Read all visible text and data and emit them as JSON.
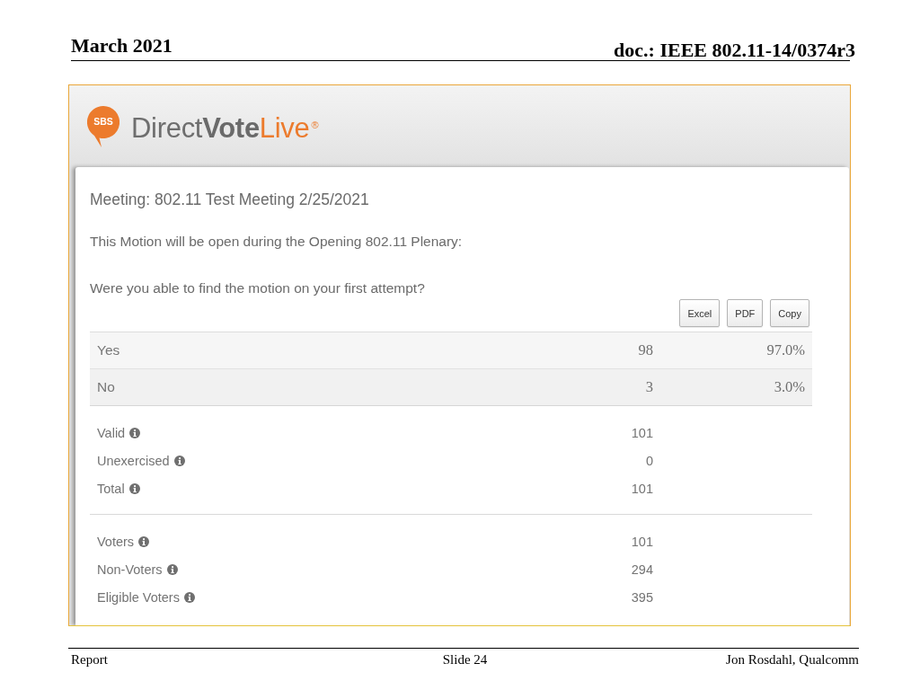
{
  "slide_header": {
    "date": "March 2021",
    "document_id": "doc.: IEEE 802.11-14/0374r3"
  },
  "vote_app": {
    "logo": {
      "badge": "SBS",
      "words": [
        {
          "text": "Direct",
          "kind": "plain"
        },
        {
          "text": "Vote",
          "kind": "strong"
        },
        {
          "text": "Live",
          "kind": "accent"
        },
        {
          "text": "®",
          "kind": "mark"
        }
      ]
    },
    "meeting": "Meeting: 802.11 Test Meeting 2/25/2021",
    "motion": "This Motion will be open during the Opening 802.11 Plenary:",
    "question": "Were you able to find the motion on your first attempt?",
    "export_buttons": [
      "Excel",
      "PDF",
      "Copy"
    ],
    "results": [
      {
        "answer": "Yes",
        "count": "98",
        "percent": "97.0%"
      },
      {
        "answer": "No",
        "count": "3",
        "percent": "3.0%"
      }
    ],
    "stat_groups": [
      {
        "rows": [
          {
            "label": "Valid",
            "value": "101"
          },
          {
            "label": "Unexercised",
            "value": "0"
          },
          {
            "label": "Total",
            "value": "101"
          }
        ]
      },
      {
        "rows": [
          {
            "label": "Voters",
            "value": "101"
          },
          {
            "label": "Non-Voters",
            "value": "294"
          },
          {
            "label": "Eligible Voters",
            "value": "395"
          }
        ]
      }
    ]
  },
  "slide_footer": {
    "left": "Report",
    "center": "Slide 24",
    "right": "Jon Rosdahl, Qualcomm"
  }
}
